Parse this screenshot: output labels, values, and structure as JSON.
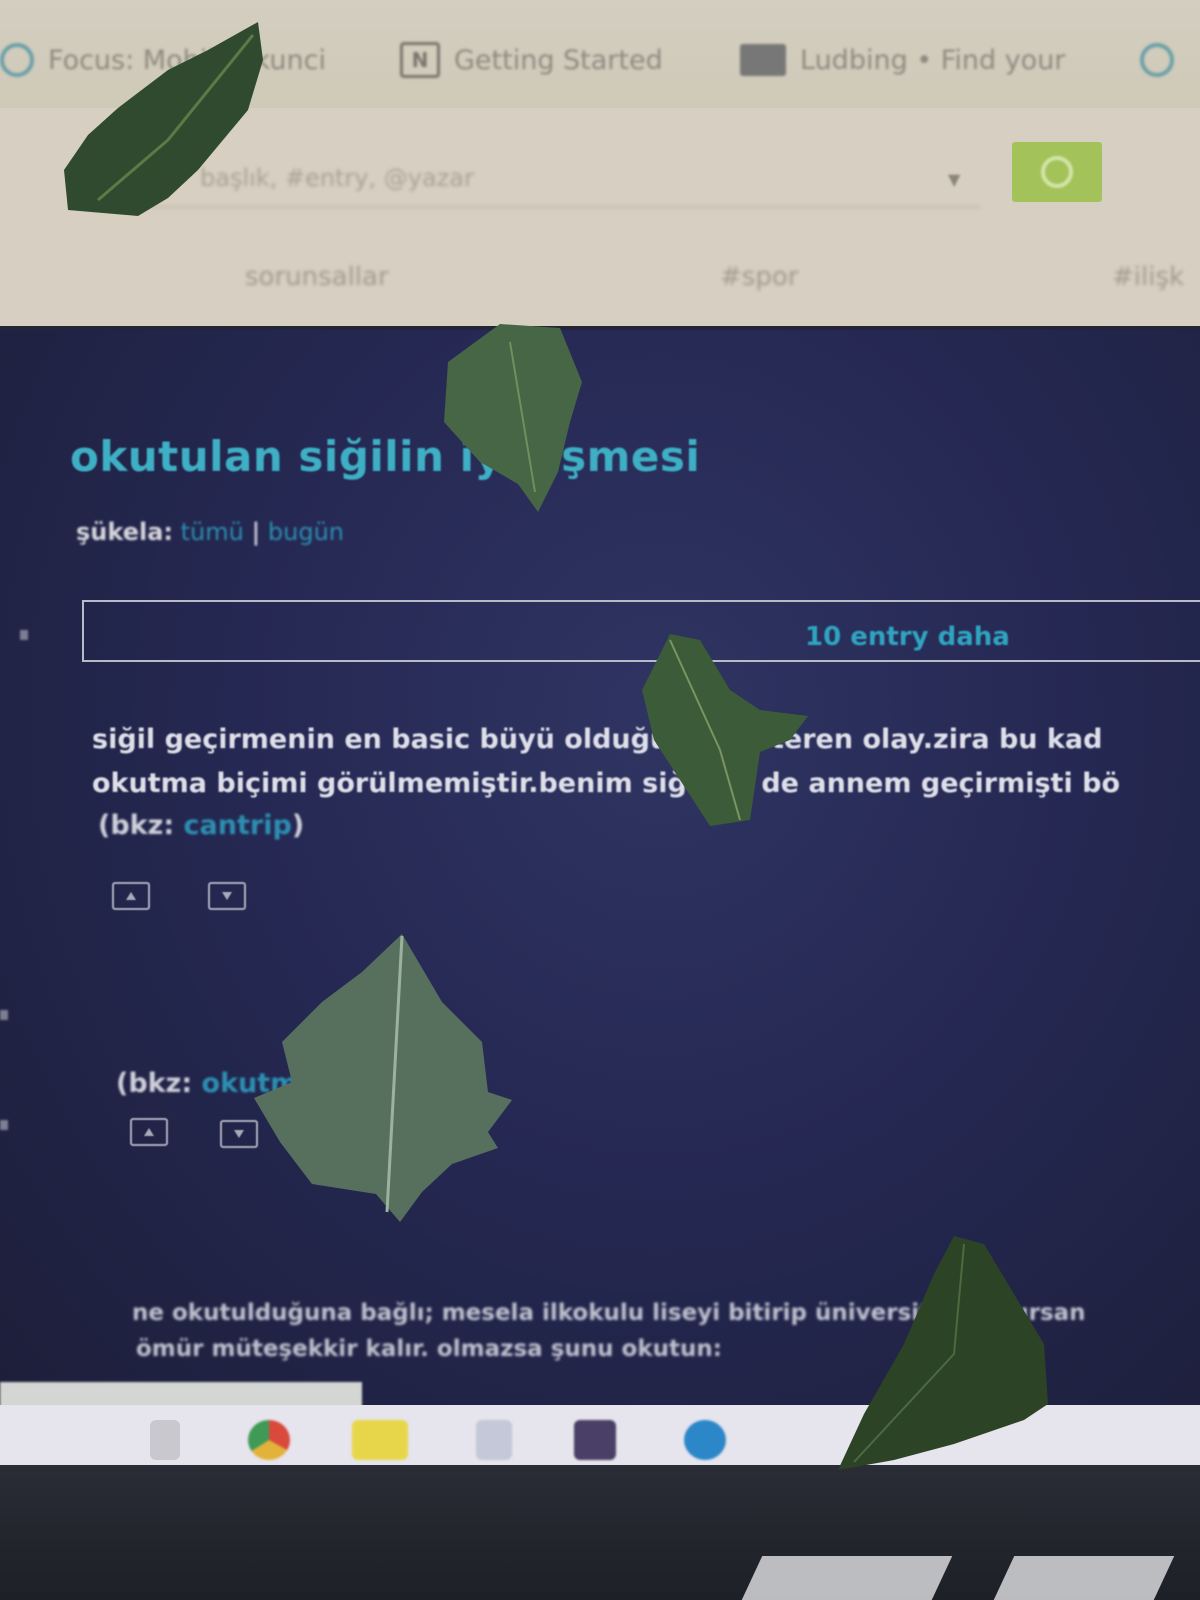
{
  "bookmarks": [
    {
      "label": "Focus: Mobil Plikunci",
      "icon": "circle-icon"
    },
    {
      "label": "Getting Started",
      "icon": "notion-icon",
      "icon_text": "N"
    },
    {
      "label": "Ludbing • Find your",
      "icon": "calendar-icon"
    }
  ],
  "search": {
    "placeholder": "başlık, #entry, @yazar",
    "button_icon": "search-icon"
  },
  "nav": [
    "sorunsallar",
    "#spor",
    "#ilişk"
  ],
  "topic": {
    "title": "okutulan siğilin iyileşmesi",
    "sukela_label": "şükela:",
    "filter_all": "tümü",
    "filter_separator": "|",
    "filter_today": "bugün",
    "more_entries": "10 entry daha"
  },
  "entries": [
    {
      "line1": "siğil geçirmenin en basic büyü olduğunu gösteren olay.zira bu kad",
      "line2": "okutma biçimi görülmemiştir.benim siğilimi de annem geçirmişti bö",
      "bkz_prefix": "(bkz: ",
      "bkz_link": "cantrip",
      "bkz_suffix": ")"
    },
    {
      "bkz_prefix": "(bkz: ",
      "bkz_link": "okutma"
    },
    {
      "line1": "ne okutulduğuna bağlı; mesela ilkokulu liseyi bitirip üniversite okutursan",
      "line2": "ömür müteşekkir kalır. olmazsa şunu okutun:"
    }
  ],
  "taskbar": [
    {
      "name": "search-icon"
    },
    {
      "name": "chrome-icon"
    },
    {
      "name": "folder-icon"
    },
    {
      "name": "app-icon"
    },
    {
      "name": "photos-icon"
    },
    {
      "name": "edge-icon"
    }
  ],
  "colors": {
    "accent": "#3eafc4",
    "link": "#2d8fb2",
    "search_button": "#a3c35a",
    "page_bg": "#252852"
  }
}
